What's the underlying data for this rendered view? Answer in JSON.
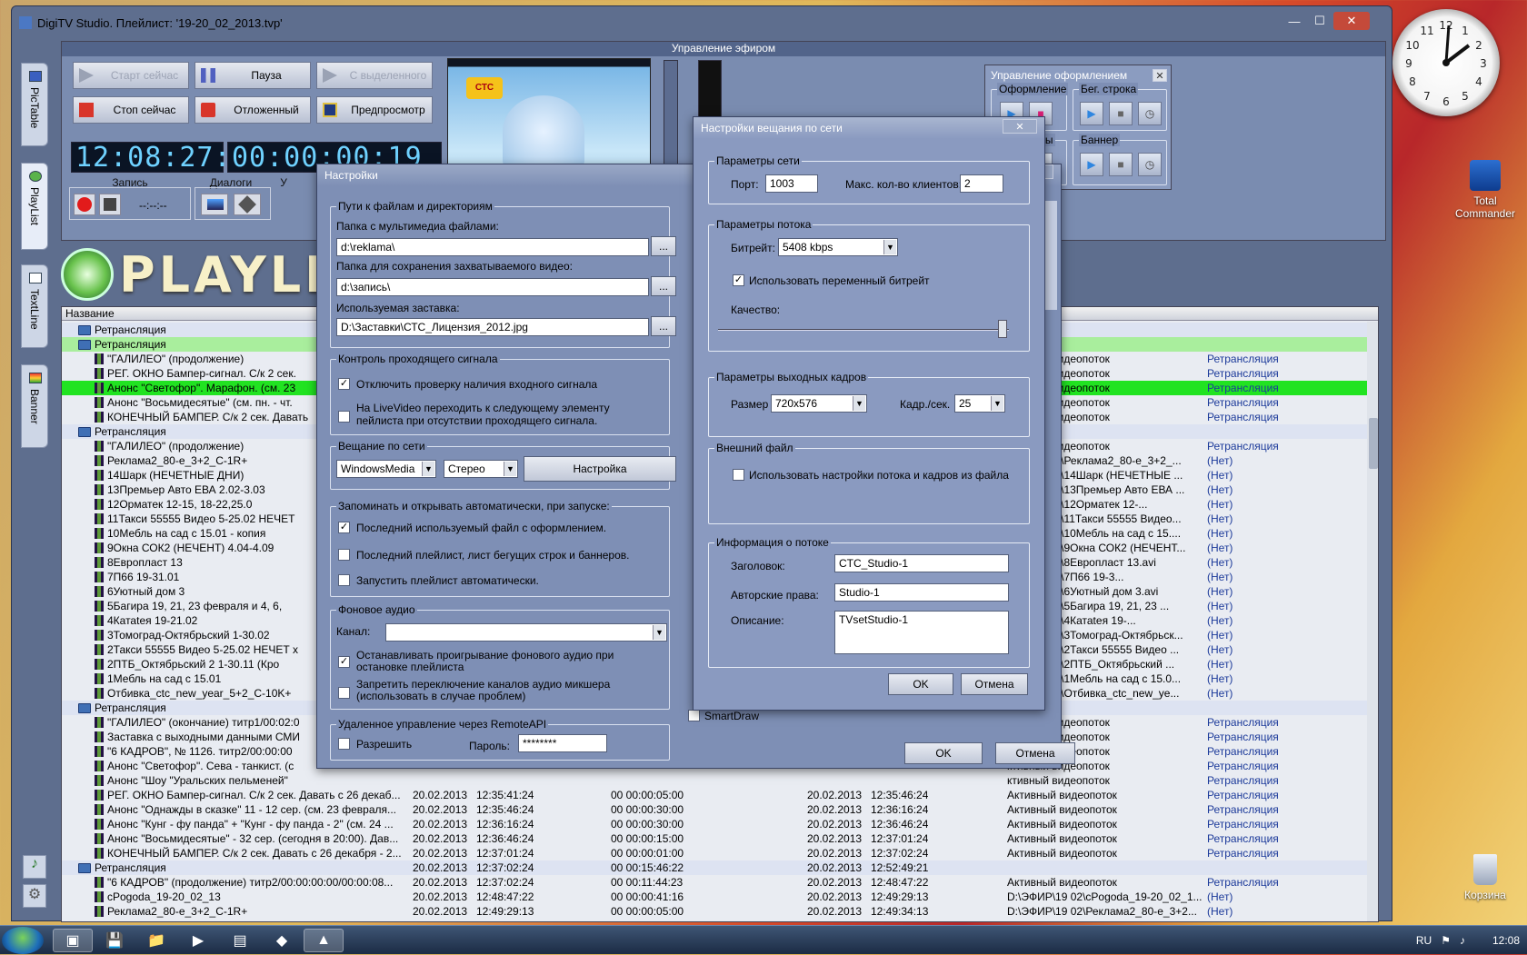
{
  "window": {
    "title": "DigiTV Studio.   Плейлист:  '19-20_02_2013.tvp'",
    "ctrl": [
      "—",
      "☐",
      "✕"
    ]
  },
  "sidebar": [
    "PicTable",
    "PlayList",
    "TextLine",
    "Banner"
  ],
  "broadcast": {
    "title": "Управление эфиром",
    "buttons": {
      "start": "Старт сейчас",
      "pause": "Пауза",
      "with_sel": "С выделенного",
      "stop": "Стоп сейчас",
      "delayed": "Отложенный",
      "preview": "Предпросмотр"
    },
    "led1": "12:08:27:00",
    "led2": "00:00:00:19",
    "rec_label": "Запись",
    "rec_time": "--:--:--",
    "dialogs_label": "Диалоги",
    "extra_label": "У"
  },
  "logo": "PLAYLI",
  "playlist": {
    "header": "Название",
    "rows": [
      {
        "t": "g",
        "n": "Ретрансляция"
      },
      {
        "t": "gs",
        "n": "Ретрансляция"
      },
      {
        "t": "i",
        "n": "\"ГАЛИЛЕО\" (продолжение)",
        "s": "ктивный видеопоток",
        "k": "Ретрансляция"
      },
      {
        "t": "i",
        "n": "РЕГ. ОКНО Бампер-сигнал. С/к 2 сек.",
        "s": "ктивный видеопоток",
        "k": "Ретрансляция"
      },
      {
        "t": "h",
        "n": "Анонс \"Светофор\". Марафон. (см. 23",
        "s": "ктивный видеопоток",
        "k": "Ретрансляция"
      },
      {
        "t": "i",
        "n": "Анонс \"Восьмидесятые\" (см. пн. - чт.",
        "s": "ктивный видеопоток",
        "k": "Ретрансляция"
      },
      {
        "t": "i",
        "n": "КОНЕЧНЫЙ БАМПЕР. С/к 2 сек. Давать",
        "s": "ктивный видеопоток",
        "k": "Ретрансляция"
      },
      {
        "t": "g",
        "n": "Ретрансляция"
      },
      {
        "t": "i",
        "n": "\"ГАЛИЛЕО\" (продолжение)",
        "s": "ктивный видеопоток",
        "k": "Ретрансляция"
      },
      {
        "t": "i",
        "n": "Реклама2_80-е_3+2_С-1R+",
        "s": "ФИР\\19 02\\Реклама2_80-е_3+2_...",
        "k": "(Нет)"
      },
      {
        "t": "i",
        "n": "14Шарк (НЕЧЕТНЫЕ ДНИ)",
        "s": "ФИР\\19 02\\14Шарк (НЕЧЕТНЫЕ ...",
        "k": "(Нет)"
      },
      {
        "t": "i",
        "n": "13Премьер Авто ЕВА  2.02-3.03",
        "s": "ФИР\\19 02\\13Премьер Авто ЕВА ...",
        "k": "(Нет)"
      },
      {
        "t": "i",
        "n": "12Орматек        12-15, 18-22,25.0",
        "s": "ФИР\\19 02\\12Орматек        12-...",
        "k": "(Нет)"
      },
      {
        "t": "i",
        "n": "11Такси 55555 Видео 5-25.02 НЕЧЕТ",
        "s": "ФИР\\19 02\\11Такси 55555 Видео...",
        "k": "(Нет)"
      },
      {
        "t": "i",
        "n": "10Мебль на сад с 15.01 - копия",
        "s": "ФИР\\19 02\\10Мебль на сад с 15....",
        "k": "(Нет)"
      },
      {
        "t": "i",
        "n": "9Окна СОК2 (НЕЧЕНТ)      4.04-4.09",
        "s": "ФИР\\19 02\\9Окна СОК2 (НЕЧЕНТ...",
        "k": "(Нет)"
      },
      {
        "t": "i",
        "n": "8Европласт    13",
        "s": "ФИР\\19 02\\8Европласт    13.avi",
        "k": "(Нет)"
      },
      {
        "t": "i",
        "n": "7П66            19-31.01",
        "s": "ФИР\\19 02\\7П66            19-3...",
        "k": "(Нет)"
      },
      {
        "t": "i",
        "n": "6Уютный дом 3",
        "s": "ФИР\\19 02\\6Уютный дом 3.avi",
        "k": "(Нет)"
      },
      {
        "t": "i",
        "n": "5Багира    19, 21, 23 февраля и 4, 6,",
        "s": "ФИР\\19 02\\5Багира    19, 21, 23 ...",
        "k": "(Нет)"
      },
      {
        "t": "i",
        "n": "4Катаtея         19-21.02",
        "s": "ФИР\\19 02\\4Катаtея         19-...",
        "k": "(Нет)"
      },
      {
        "t": "i",
        "n": "3Томоград-Октябрьский     1-30.02",
        "s": "ФИР\\19 02\\3Томоград-Октябрьск...",
        "k": "(Нет)"
      },
      {
        "t": "i",
        "n": "2Такси 55555 Видео 5-25.02 НЕЧЕТ х",
        "s": "ФИР\\19 02\\2Такси 55555 Видео ...",
        "k": "(Нет)"
      },
      {
        "t": "i",
        "n": "2ПТБ_Октябрьский  2   1-30.11 (Кро",
        "s": "ФИР\\19 02\\2ПТБ_Октябрьский    ...",
        "k": "(Нет)"
      },
      {
        "t": "i",
        "n": "1Мебль на сад с 15.01",
        "s": "ФИР\\19 02\\1Мебль на сад с 15.0...",
        "k": "(Нет)"
      },
      {
        "t": "i",
        "n": "Отбивка_ctc_new_year_5+2_C-10K+",
        "s": "ФИР\\19 02\\Отбивка_ctc_new_ye...",
        "k": "(Нет)"
      },
      {
        "t": "g",
        "n": "Ретрансляция"
      },
      {
        "t": "i",
        "n": "\"ГАЛИЛЕО\" (окончание) титр1/00:02:0",
        "s": "ктивный видеопоток",
        "k": "Ретрансляция"
      },
      {
        "t": "i",
        "n": "Заставка с выходными данными СМИ",
        "s": "ктивный видеопоток",
        "k": "Ретрансляция"
      },
      {
        "t": "i",
        "n": "\"6 КАДРОВ\", № 1126. титр2/00:00:00",
        "s": "ктивный видеопоток",
        "k": "Ретрансляция"
      },
      {
        "t": "i",
        "n": "Анонс \"Светофор\". Сева - танкист. (с",
        "s": "ктивный видеопоток",
        "k": "Ретрансляция"
      },
      {
        "t": "i",
        "n": "Анонс \"Шоу \"Уральских пельменей\"",
        "s": "ктивный видеопоток",
        "k": "Ретрансляция"
      },
      {
        "t": "i",
        "n": "РЕГ. ОКНО Бампер-сигнал. С/к 2 сек. Давать с 26 декаб...",
        "d": "20.02.2013",
        "st": "12:35:41:24",
        "du": "00 00:00:05:00",
        "ed": "20.02.2013",
        "et": "12:35:46:24",
        "s": "Активный видеопоток",
        "k": "Ретрансляция"
      },
      {
        "t": "i",
        "n": "Анонс \"Однажды в сказке\" 11 - 12 сер. (см. 23 февраля...",
        "d": "20.02.2013",
        "st": "12:35:46:24",
        "du": "00 00:00:30:00",
        "ed": "20.02.2013",
        "et": "12:36:16:24",
        "s": "Активный видеопоток",
        "k": "Ретрансляция"
      },
      {
        "t": "i",
        "n": "Анонс \"Кунг - фу панда\" + \"Кунг - фу панда - 2\" (см. 24 ...",
        "d": "20.02.2013",
        "st": "12:36:16:24",
        "du": "00 00:00:30:00",
        "ed": "20.02.2013",
        "et": "12:36:46:24",
        "s": "Активный видеопоток",
        "k": "Ретрансляция"
      },
      {
        "t": "i",
        "n": "Анонс \"Восьмидесятые\" - 32 сер. (сегодня в 20:00). Дав...",
        "d": "20.02.2013",
        "st": "12:36:46:24",
        "du": "00 00:00:15:00",
        "ed": "20.02.2013",
        "et": "12:37:01:24",
        "s": "Активный видеопоток",
        "k": "Ретрансляция"
      },
      {
        "t": "i",
        "n": "КОНЕЧНЫЙ БАМПЕР. С/к 2 сек. Давать с 26 декабря - 2...",
        "d": "20.02.2013",
        "st": "12:37:01:24",
        "du": "00 00:00:01:00",
        "ed": "20.02.2013",
        "et": "12:37:02:24",
        "s": "Активный видеопоток",
        "k": "Ретрансляция"
      },
      {
        "t": "g",
        "n": "Ретрансляция",
        "d": "20.02.2013",
        "st": "12:37:02:24",
        "du": "00 00:15:46:22",
        "ed": "20.02.2013",
        "et": "12:52:49:21"
      },
      {
        "t": "i",
        "n": "\"6 КАДРОВ\" (продолжение) титр2/00:00:00:00/00:00:08...",
        "d": "20.02.2013",
        "st": "12:37:02:24",
        "du": "00 00:11:44:23",
        "ed": "20.02.2013",
        "et": "12:48:47:22",
        "s": "Активный видеопоток",
        "k": "Ретрансляция"
      },
      {
        "t": "i",
        "n": "cPogoda_19-20_02_13",
        "d": "20.02.2013",
        "st": "12:48:47:22",
        "du": "00 00:00:41:16",
        "ed": "20.02.2013",
        "et": "12:49:29:13",
        "s": "D:\\ЭФИР\\19 02\\cPogoda_19-20_02_1...",
        "k": "(Нет)"
      },
      {
        "t": "i",
        "n": "Реклама2_80-е_3+2_С-1R+",
        "d": "20.02.2013",
        "st": "12:49:29:13",
        "du": "00 00:00:05:00",
        "ed": "20.02.2013",
        "et": "12:49:34:13",
        "s": "D:\\ЭФИР\\19 02\\Реклама2_80-е_3+2...",
        "k": "(Нет)"
      }
    ]
  },
  "design": {
    "title": "Управление оформлением",
    "g1": "Оформление",
    "g2": "Бег. строка",
    "g3": "Лого, часы",
    "g4": "Баннер"
  },
  "settings": {
    "title": "Настройки",
    "paths": {
      "legend": "Пути к файлам и директориям",
      "media_lbl": "Папка с мультимедиа файлами:",
      "media": "d:\\reklama\\",
      "cap_lbl": "Папка для сохранения захватываемого видео:",
      "cap": "d:\\запись\\",
      "splash_lbl": "Используемая заставка:",
      "splash": "D:\\Заставки\\СТС_Лицензия_2012.jpg",
      "browse": "..."
    },
    "signal": {
      "legend": "Контроль проходящего сигнала",
      "c1": "Отключить проверку наличия входного сигнала",
      "c2a": "На LiveVideo переходить к следующему элементу",
      "c2b": "пейлиста при отсутствии проходящего сигнала."
    },
    "net": {
      "legend": "Вещание по сети",
      "codec": "WindowsMedia",
      "mode": "Стерео",
      "btn": "Настройка"
    },
    "auto": {
      "legend": "Запоминать и открывать автоматически, при запуске:",
      "c1": "Последний используемый файл с оформлением.",
      "c2": "Последний плейлист, лист бегущих строк и баннеров.",
      "c3": "Запустить плейлист автоматически."
    },
    "audio": {
      "legend": "Фоновое аудио",
      "chan": "Канал:",
      "c1a": "Останавливать проигрывание фонового аудио при",
      "c1b": "остановке плейлиста",
      "c2a": "Запретить переключение каналов аудио микшера",
      "c2b": "(использовать в случае проблем)"
    },
    "remote": {
      "legend": "Удаленное управление через RemoteAPI",
      "allow": "Разрешить",
      "pw_lbl": "Пароль:",
      "pw": "********"
    },
    "ok": "OK",
    "cancel": "Отмена",
    "smartdraw": "SmartDraw"
  },
  "net_dialog": {
    "title": "Настройки вещания по сети",
    "np": {
      "legend": "Параметры сети",
      "port_lbl": "Порт:",
      "port": "1003",
      "max_lbl": "Макс. кол-во клиентов:",
      "max": "2"
    },
    "sp": {
      "legend": "Параметры потока",
      "br_lbl": "Битрейт:",
      "br": "5408 kbps",
      "vbr": "Использовать переменный битрейт",
      "q": "Качество:"
    },
    "fp": {
      "legend": "Параметры выходных кадров",
      "size_lbl": "Размер",
      "size": "720x576",
      "fps_lbl": "Кадр./сек.",
      "fps": "25"
    },
    "ext": {
      "legend": "Внешний файл",
      "c": "Использовать настройки потока и кадров  из файла"
    },
    "info": {
      "legend": "Информация о потоке",
      "h_lbl": "Заголовок:",
      "h": "CTC_Studio-1",
      "a_lbl": "Авторские права:",
      "a": "Studio-1",
      "d_lbl": "Описание:",
      "d": "TVsetStudio-1"
    },
    "ok": "OK",
    "cancel": "Отмена"
  },
  "desktop": {
    "tc": "Total\nCommander",
    "bin": "Корзина"
  },
  "tray": {
    "lang": "RU",
    "time": "12:08"
  }
}
